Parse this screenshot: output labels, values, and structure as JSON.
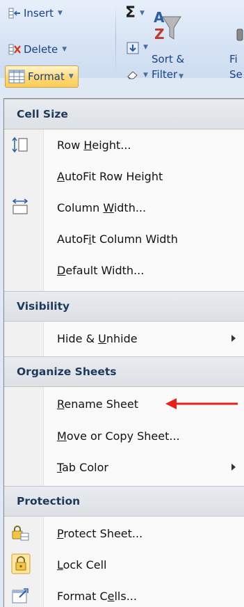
{
  "ribbon": {
    "insert_label": "Insert",
    "delete_label": "Delete",
    "format_label": "Format",
    "sort_filter_line1": "Sort &",
    "sort_filter_line2": "Filter",
    "find_select_line1": "Fi",
    "find_select_line2": "Se",
    "icons": [
      "insert-cells-icon",
      "delete-cells-icon",
      "format-cells-icon",
      "autosum-icon",
      "fill-icon",
      "clear-eraser-icon",
      "sort-filter-icon",
      "find-select-icon"
    ]
  },
  "menu": {
    "sections": {
      "cell_size": "Cell Size",
      "visibility": "Visibility",
      "organize": "Organize Sheets",
      "protection": "Protection"
    },
    "items": {
      "row_height": "Row Height...",
      "autofit_row": "AutoFit Row Height",
      "column_width": "Column Width...",
      "autofit_column": "AutoFit Column Width",
      "default_width": "Default Width...",
      "hide_unhide": "Hide & Unhide",
      "rename_sheet": "Rename Sheet",
      "move_copy": "Move or Copy Sheet...",
      "tab_color": "Tab Color",
      "protect_sheet": "Protect Sheet...",
      "lock_cell": "Lock Cell",
      "format_cells": "Format Cells..."
    }
  },
  "colors": {
    "ribbon_text": "#15428b",
    "format_button_highlight": "#ffd979",
    "annotation_arrow": "#e8201a",
    "section_header_bg": "#dde1e6"
  }
}
